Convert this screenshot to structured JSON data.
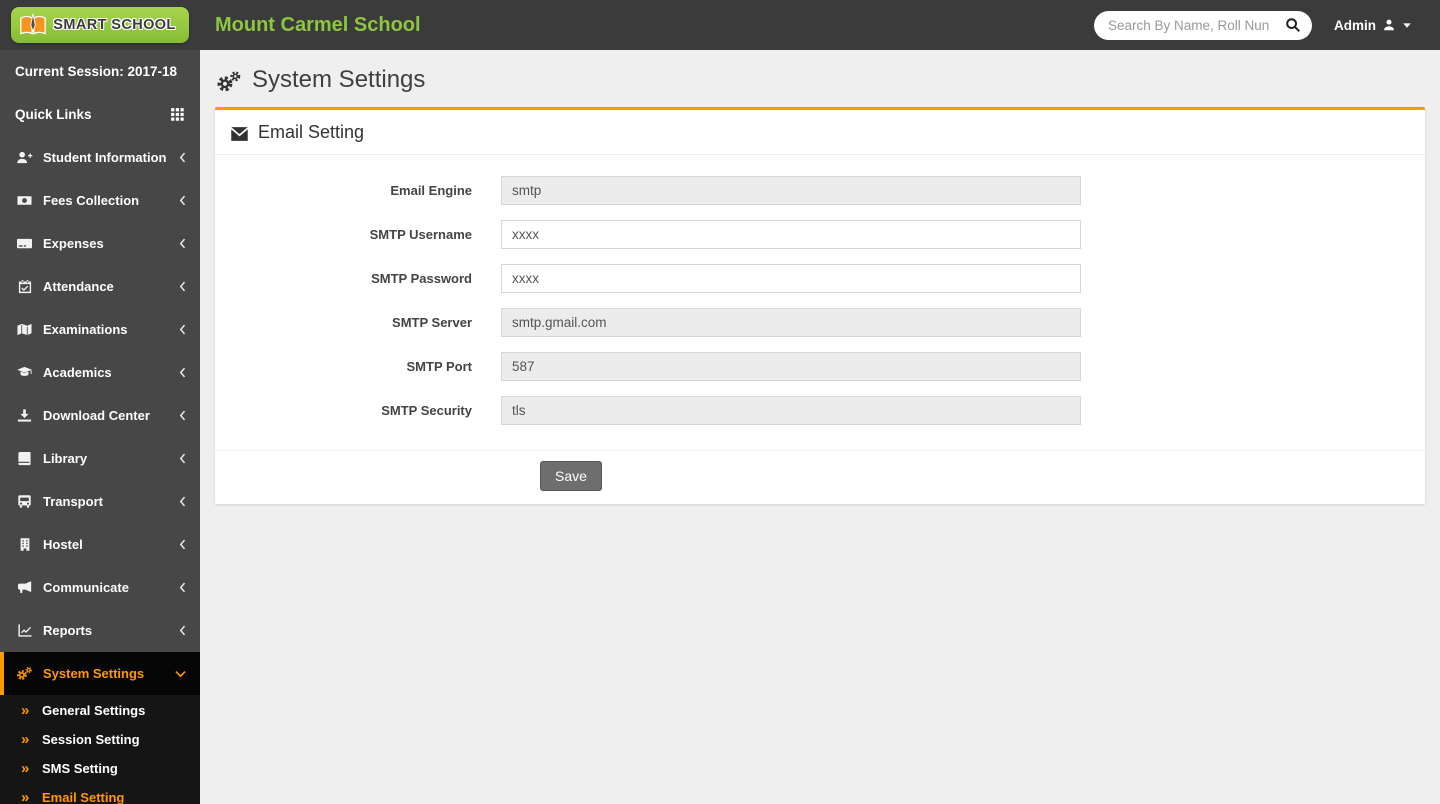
{
  "header": {
    "logo_text": "SMART SCHOOL",
    "school_name": "Mount Carmel School",
    "search_placeholder": "Search By Name, Roll Nun",
    "admin_label": "Admin"
  },
  "sidebar": {
    "session_label": "Current Session: 2017-18",
    "quick_links_label": "Quick Links",
    "items": [
      {
        "label": "Student Information"
      },
      {
        "label": "Fees Collection"
      },
      {
        "label": "Expenses"
      },
      {
        "label": "Attendance"
      },
      {
        "label": "Examinations"
      },
      {
        "label": "Academics"
      },
      {
        "label": "Download Center"
      },
      {
        "label": "Library"
      },
      {
        "label": "Transport"
      },
      {
        "label": "Hostel"
      },
      {
        "label": "Communicate"
      },
      {
        "label": "Reports"
      },
      {
        "label": "System Settings"
      }
    ],
    "submenu": [
      {
        "label": "General Settings"
      },
      {
        "label": "Session Setting"
      },
      {
        "label": "SMS Setting"
      },
      {
        "label": "Email Setting"
      }
    ],
    "submenu_bullet": "»"
  },
  "main": {
    "page_title": "System Settings",
    "card_title": "Email Setting",
    "fields": [
      {
        "label": "Email Engine",
        "value": "smtp"
      },
      {
        "label": "SMTP Username",
        "value": "xxxx"
      },
      {
        "label": "SMTP Password",
        "value": "xxxx"
      },
      {
        "label": "SMTP Server",
        "value": "smtp.gmail.com"
      },
      {
        "label": "SMTP Port",
        "value": "587"
      },
      {
        "label": "SMTP Security",
        "value": "tls"
      }
    ],
    "save_label": "Save"
  },
  "colors": {
    "accent_orange": "#ff9801",
    "brand_green": "#8dc63f",
    "header_bg": "#3b3b3b",
    "sidebar_bg": "#474747",
    "submenu_bg": "#151515",
    "page_bg": "#efefef",
    "disabled_input_bg": "#ececec",
    "save_button_bg": "#6e6e6e"
  }
}
